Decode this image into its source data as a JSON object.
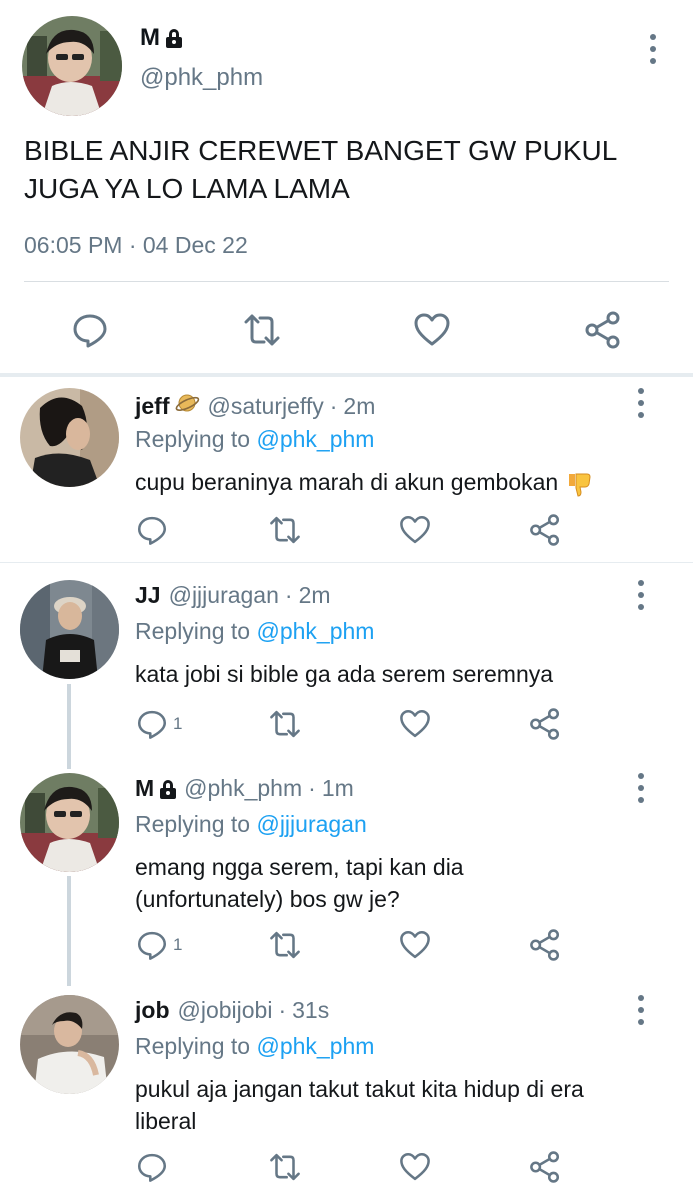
{
  "main_tweet": {
    "name": "M",
    "locked": true,
    "handle": "@phk_phm",
    "text": "BIBLE ANJIR CEREWET BANGET GW PUKUL JUGA YA LO LAMA LAMA",
    "timestamp": "06:05 PM · 04 Dec 22",
    "actions": [
      "reply-icon",
      "retweet-icon",
      "like-icon",
      "share-icon"
    ]
  },
  "replies": [
    {
      "name": "jeff",
      "name_emoji": "planet-icon",
      "handle": "@saturjeffy",
      "dot": "·",
      "time": "2m",
      "replying_prefix": "Replying to",
      "replying_to": "@phk_phm",
      "text": "cupu beraninya marah di akun gembokan",
      "text_emoji": "thumbs-down-icon",
      "reply_count": ""
    },
    {
      "name": "JJ",
      "handle": "@jjjuragan",
      "dot": "·",
      "time": "2m",
      "replying_prefix": "Replying to",
      "replying_to": "@phk_phm",
      "text": "kata jobi si bible ga ada serem seremnya",
      "reply_count": "1"
    },
    {
      "name": "M",
      "locked": true,
      "handle": "@phk_phm",
      "dot": "·",
      "time": "1m",
      "replying_prefix": "Replying to",
      "replying_to": "@jjjuragan",
      "text": "emang ngga serem, tapi kan dia (unfortunately) bos gw je?",
      "reply_count": "1"
    },
    {
      "name": "job",
      "handle": "@jobijobi",
      "dot": "·",
      "time": "31s",
      "replying_prefix": "Replying to",
      "replying_to": "@phk_phm",
      "text": "pukul aja jangan takut takut kita hidup di era liberal",
      "reply_count": ""
    }
  ],
  "colors": {
    "text": "#14171a",
    "secondary": "#657786",
    "link": "#1da1f2",
    "divider": "#e6ecf0"
  }
}
